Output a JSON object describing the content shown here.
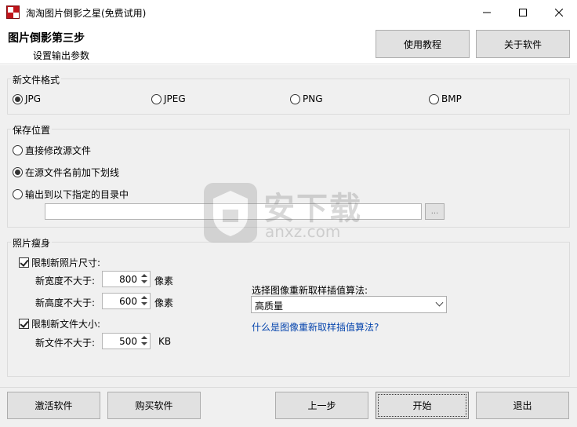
{
  "window": {
    "title": "淘淘图片倒影之星(免费试用)",
    "app_icon": "app-logo-icon"
  },
  "header": {
    "step_title": "图片倒影第三步",
    "step_subtitle": "设置输出参数",
    "help_button": "使用教程",
    "about_button": "关于软件"
  },
  "format": {
    "group_label": "新文件格式",
    "options": [
      "JPG",
      "JPEG",
      "PNG",
      "BMP"
    ],
    "selected": "JPG"
  },
  "save": {
    "group_label": "保存位置",
    "options": [
      "直接修改源文件",
      "在源文件名前加下划线",
      "输出到以下指定的目录中"
    ],
    "selected": "在源文件名前加下划线",
    "dir_value": "",
    "browse_label": "..."
  },
  "resize": {
    "group_label": "照片瘦身",
    "limit_size_label": "限制新照片尺寸:",
    "limit_size_checked": true,
    "width_label": "新宽度不大于:",
    "width_value": "800",
    "height_label": "新高度不大于:",
    "height_value": "600",
    "pixel_unit": "像素",
    "limit_file_label": "限制新文件大小:",
    "limit_file_checked": true,
    "file_label": "新文件不大于:",
    "file_value": "500",
    "file_unit": "KB",
    "algo_label": "选择图像重新取样插值算法:",
    "algo_value": "高质量",
    "algo_link": "什么是图像重新取样插值算法?"
  },
  "watermark": {
    "text": "安下载",
    "sub": "anxz.com"
  },
  "footer": {
    "activate": "激活软件",
    "buy": "购买软件",
    "prev": "上一步",
    "start": "开始",
    "exit": "退出"
  },
  "colors": {
    "link": "#0645ad",
    "app_icon": "#c0141a"
  }
}
